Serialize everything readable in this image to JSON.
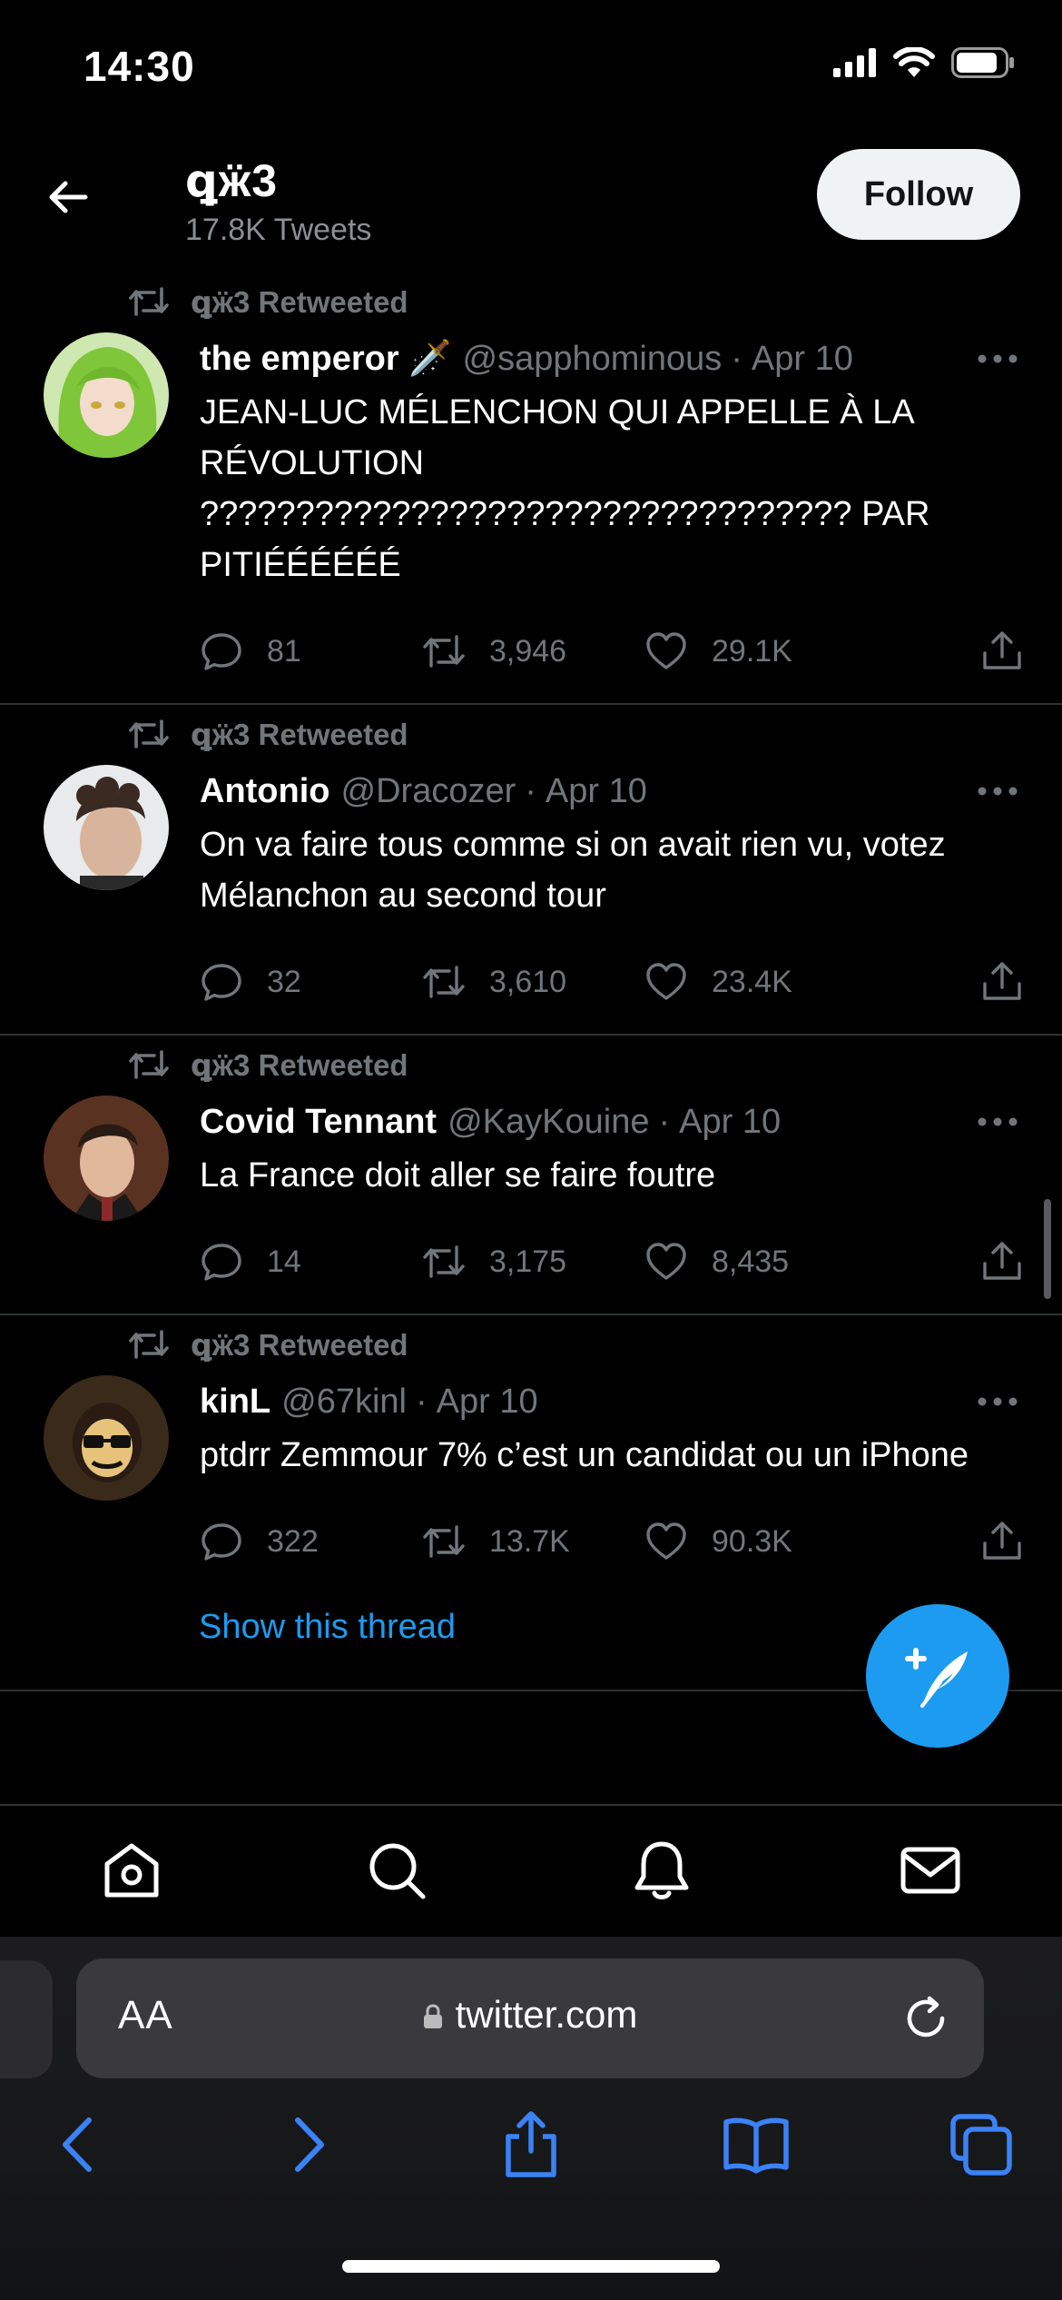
{
  "status": {
    "time": "14:30"
  },
  "header": {
    "name": "ꝗӝ3",
    "tweet_count": "17.8K Tweets",
    "follow_label": "Follow"
  },
  "tweets": [
    {
      "retweeted_label": "ꝗӝ3 Retweeted",
      "name": "the emperor 🗡️",
      "handle": "@sapphominous",
      "date": "Apr 10",
      "text": "JEAN-LUC MÉLENCHON QUI APPELLE À LA RÉVOLUTION ?????????????????????????????????? PAR PITIÉÉÉÉÉÉ",
      "replies": "81",
      "retweets": "3,946",
      "likes": "29.1K",
      "avatar_color": "#9bc94a"
    },
    {
      "retweeted_label": "ꝗӝ3 Retweeted",
      "name": "Antonio",
      "handle": "@Dracozer",
      "date": "Apr 10",
      "text": "On va faire tous comme si on avait rien vu, votez Mélanchon au second tour",
      "replies": "32",
      "retweets": "3,610",
      "likes": "23.4K",
      "avatar_color": "#cfd2d4"
    },
    {
      "retweeted_label": "ꝗӝ3 Retweeted",
      "name": "Covid Tennant",
      "handle": "@KayKouine",
      "date": "Apr 10",
      "text": "La France doit aller se faire foutre",
      "replies": "14",
      "retweets": "3,175",
      "likes": "8,435",
      "avatar_color": "#4a2a1c"
    },
    {
      "retweeted_label": "ꝗӝ3 Retweeted",
      "name": "kinL",
      "handle": "@67kinl",
      "date": "Apr 10",
      "text": "ptdrr Zemmour 7% c’est un candidat ou un iPhone",
      "replies": "322",
      "retweets": "13.7K",
      "likes": "90.3K",
      "avatar_color": "#c9a65a",
      "thread_link": "Show this thread"
    }
  ],
  "tabbar": {
    "items": [
      "home-icon",
      "search-icon",
      "notifications-icon",
      "messages-icon"
    ]
  },
  "safari": {
    "aa_label": "AA",
    "domain": "twitter.com"
  },
  "colors": {
    "accent": "#1d9bf0",
    "muted": "#71767b",
    "divider": "#2f3336"
  }
}
